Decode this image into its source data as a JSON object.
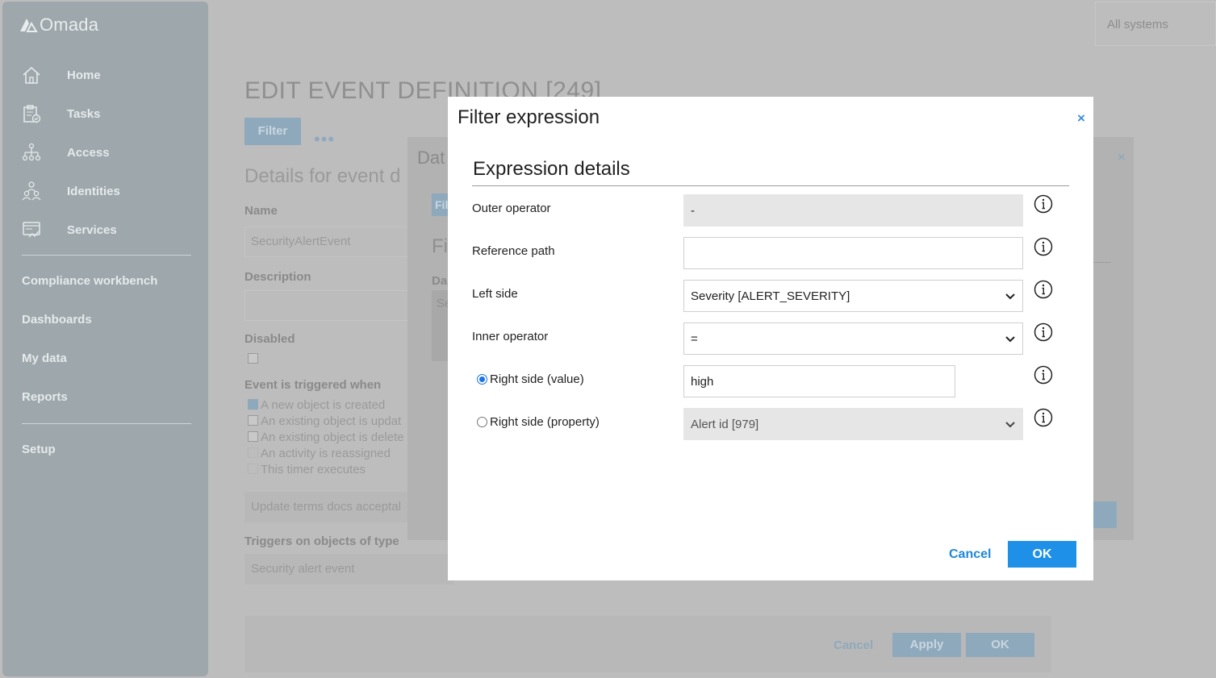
{
  "app": {
    "logo_text": "Omada"
  },
  "sidebar": {
    "items": [
      {
        "label": "Home",
        "icon": "home-icon"
      },
      {
        "label": "Tasks",
        "icon": "clipboard-icon"
      },
      {
        "label": "Access",
        "icon": "hierarchy-icon"
      },
      {
        "label": "Identities",
        "icon": "people-icon"
      },
      {
        "label": "Services",
        "icon": "services-icon"
      }
    ],
    "secondary": [
      "Compliance workbench",
      "Dashboards",
      "My data",
      "Reports"
    ],
    "setup": "Setup"
  },
  "header": {
    "system_select": "All systems"
  },
  "page": {
    "title": "EDIT EVENT DEFINITION [249]",
    "tab_filter": "Filter",
    "tab_more": "•••",
    "subtitle": "Details for event d",
    "name_label": "Name",
    "name_value": "SecurityAlertEvent",
    "description_label": "Description",
    "disabled_label": "Disabled",
    "trigger_label": "Event is triggered when",
    "triggers": [
      {
        "label": "A new object is created",
        "checked": true
      },
      {
        "label": "An existing object is updat",
        "checked": false
      },
      {
        "label": "An existing object is delete",
        "checked": false
      },
      {
        "label": "An activity is reassigned",
        "checked": false
      },
      {
        "label": "This timer executes",
        "checked": false
      }
    ],
    "update_field": "Update terms docs acceptal",
    "object_type_label": "Triggers on objects of type",
    "object_type_value": "Security alert event",
    "cancel": "Cancel",
    "apply": "Apply",
    "ok": "OK"
  },
  "middle_dialog": {
    "title": "Dat",
    "tab": "Fil",
    "subtitle": "Fi",
    "field_label": "Da",
    "field_value": "Se"
  },
  "modal": {
    "title": "Filter expression",
    "close": "×",
    "section_title": "Expression details",
    "rows": {
      "outer_operator": {
        "label": "Outer operator",
        "value": "-"
      },
      "reference_path": {
        "label": "Reference path",
        "value": ""
      },
      "left_side": {
        "label": "Left side",
        "value": "Severity [ALERT_SEVERITY]"
      },
      "inner_operator": {
        "label": "Inner operator",
        "value": "="
      },
      "right_value": {
        "label": "Right side (value)",
        "value": "high",
        "selected": true
      },
      "right_property": {
        "label": "Right side (property)",
        "value": "Alert id [979]",
        "selected": false
      }
    },
    "cancel": "Cancel",
    "ok": "OK"
  },
  "colors": {
    "accent": "#1e90e8",
    "link": "#1e88d8",
    "overlay": "#bdbdbd",
    "sidebar": "#9ea7ab"
  }
}
